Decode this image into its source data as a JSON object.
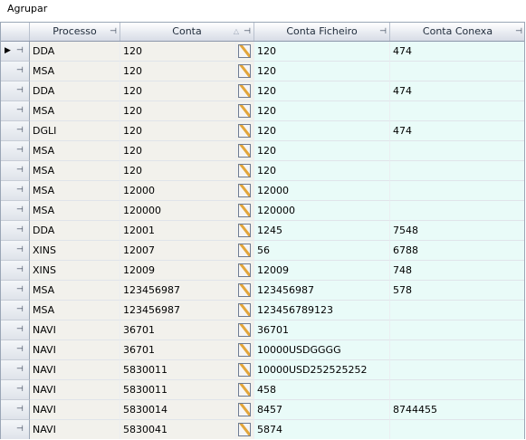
{
  "group_panel": {
    "label": "Agrupar"
  },
  "headers": {
    "processo": "Processo",
    "conta": "Conta",
    "conta_ficheiro": "Conta Ficheiro",
    "conta_conexa": "Conta Conexa",
    "pin_icon": "pin-icon",
    "sort_icon": "sort-ascending-icon"
  },
  "rows": [
    {
      "processo": "DDA",
      "conta": "120",
      "conta_ficheiro": "120",
      "conta_conexa": "474",
      "current": true
    },
    {
      "processo": "MSA",
      "conta": "120",
      "conta_ficheiro": "120",
      "conta_conexa": ""
    },
    {
      "processo": "DDA",
      "conta": "120",
      "conta_ficheiro": "120",
      "conta_conexa": "474"
    },
    {
      "processo": "MSA",
      "conta": "120",
      "conta_ficheiro": "120",
      "conta_conexa": ""
    },
    {
      "processo": "DGLI",
      "conta": "120",
      "conta_ficheiro": "120",
      "conta_conexa": "474"
    },
    {
      "processo": "MSA",
      "conta": "120",
      "conta_ficheiro": "120",
      "conta_conexa": ""
    },
    {
      "processo": "MSA",
      "conta": "120",
      "conta_ficheiro": "120",
      "conta_conexa": ""
    },
    {
      "processo": "MSA",
      "conta": "12000",
      "conta_ficheiro": "12000",
      "conta_conexa": ""
    },
    {
      "processo": "MSA",
      "conta": "120000",
      "conta_ficheiro": "120000",
      "conta_conexa": ""
    },
    {
      "processo": "DDA",
      "conta": "12001",
      "conta_ficheiro": "1245",
      "conta_conexa": "7548"
    },
    {
      "processo": "XINS",
      "conta": "12007",
      "conta_ficheiro": "56",
      "conta_conexa": "6788"
    },
    {
      "processo": "XINS",
      "conta": "12009",
      "conta_ficheiro": "12009",
      "conta_conexa": "748"
    },
    {
      "processo": "MSA",
      "conta": "123456987",
      "conta_ficheiro": "123456987",
      "conta_conexa": "578"
    },
    {
      "processo": "MSA",
      "conta": "123456987",
      "conta_ficheiro": "123456789123",
      "conta_conexa": ""
    },
    {
      "processo": "NAVI",
      "conta": "36701",
      "conta_ficheiro": "36701",
      "conta_conexa": ""
    },
    {
      "processo": "NAVI",
      "conta": "36701",
      "conta_ficheiro": "10000USDGGGG",
      "conta_conexa": ""
    },
    {
      "processo": "NAVI",
      "conta": "5830011",
      "conta_ficheiro": "10000USD252525252",
      "conta_conexa": ""
    },
    {
      "processo": "NAVI",
      "conta": "5830011",
      "conta_ficheiro": "458",
      "conta_conexa": ""
    },
    {
      "processo": "NAVI",
      "conta": "5830014",
      "conta_ficheiro": "8457",
      "conta_conexa": "8744455"
    },
    {
      "processo": "NAVI",
      "conta": "5830041",
      "conta_ficheiro": "5874",
      "conta_conexa": ""
    }
  ],
  "icons": {
    "row_pin": "pin-icon",
    "edit": "edit-pencil-icon",
    "current_row": "current-row-arrow-icon"
  }
}
